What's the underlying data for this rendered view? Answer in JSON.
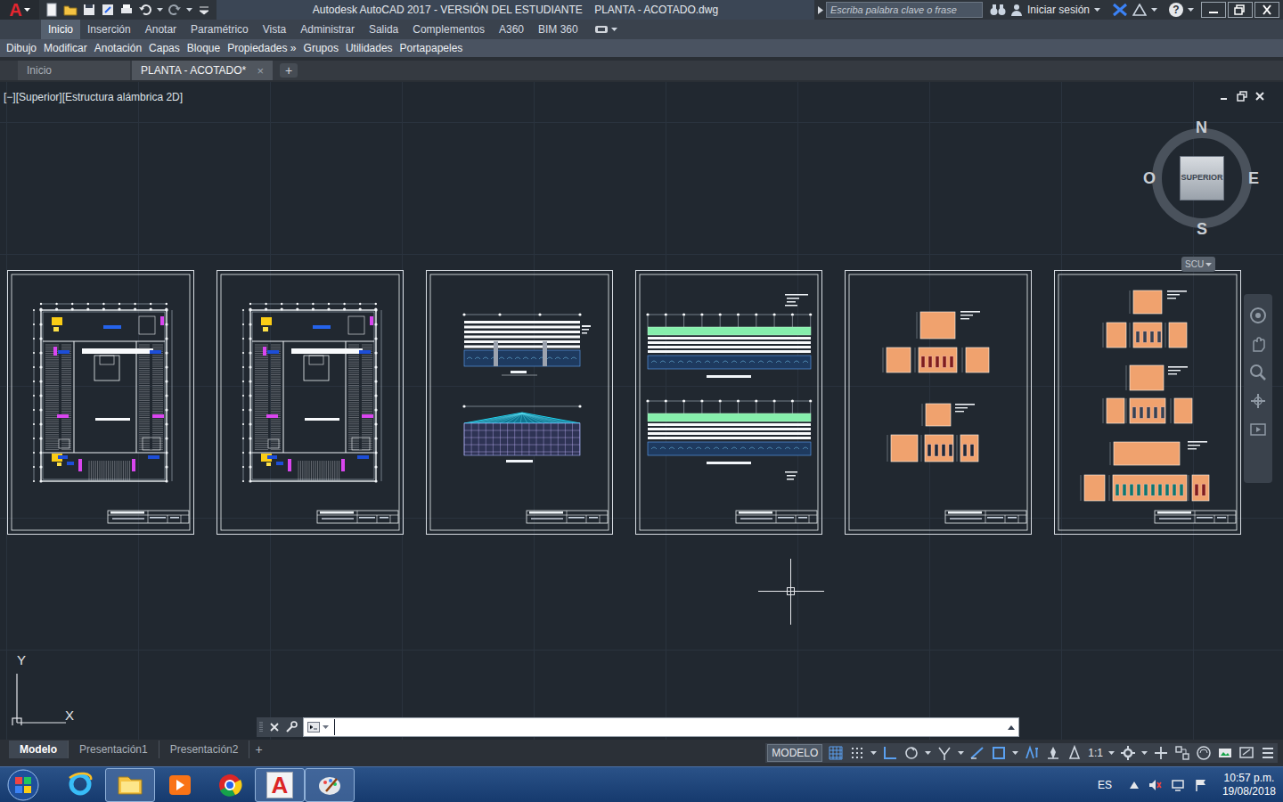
{
  "window": {
    "app_letter": "A",
    "title": "Autodesk AutoCAD 2017 - VERSIÓN DEL ESTUDIANTE    PLANTA - ACOTADO.dwg"
  },
  "search": {
    "placeholder": "Escriba palabra clave o frase"
  },
  "user": {
    "label": "Iniciar sesión"
  },
  "help": {
    "label": "?"
  },
  "ribbon_tabs": [
    {
      "label": "Inicio",
      "selected": true
    },
    {
      "label": "Inserción",
      "selected": false
    },
    {
      "label": "Anotar",
      "selected": false
    },
    {
      "label": "Paramétrico",
      "selected": false
    },
    {
      "label": "Vista",
      "selected": false
    },
    {
      "label": "Administrar",
      "selected": false
    },
    {
      "label": "Salida",
      "selected": false
    },
    {
      "label": "Complementos",
      "selected": false
    },
    {
      "label": "A360",
      "selected": false
    },
    {
      "label": "BIM 360",
      "selected": false
    }
  ],
  "panels": [
    "Dibujo",
    "Modificar",
    "Anotación",
    "Capas",
    "Bloque",
    "Propiedades »",
    "Grupos",
    "Utilidades",
    "Portapapeles"
  ],
  "file_tabs": [
    {
      "label": "Inicio",
      "selected": false,
      "closable": false
    },
    {
      "label": "PLANTA - ACOTADO*",
      "selected": true,
      "closable": true
    }
  ],
  "file_tab_close": "×",
  "new_file_tab": "+",
  "viewport": {
    "label": "[−][Superior][Estructura alámbrica 2D]"
  },
  "viewcube": {
    "face": "SUPERIOR",
    "north": "N",
    "south": "S",
    "east": "E",
    "west": "O",
    "ucs": "SCU"
  },
  "ucs_axes": {
    "x": "X",
    "y": "Y"
  },
  "sheets": [
    {
      "kind": "plan"
    },
    {
      "kind": "plan"
    },
    {
      "kind": "elevation"
    },
    {
      "kind": "long-elevation"
    },
    {
      "kind": "detail-a"
    },
    {
      "kind": "detail-b"
    }
  ],
  "command_line": {
    "value": ""
  },
  "layout_tabs": [
    {
      "label": "Modelo",
      "selected": true
    },
    {
      "label": "Presentación1",
      "selected": false
    },
    {
      "label": "Presentación2",
      "selected": false
    }
  ],
  "new_layout_tab": "+",
  "status_bar": {
    "space": "MODELO",
    "scale": "1:1"
  },
  "taskbar": {
    "language": "ES",
    "time": "10:57 p.m.",
    "date": "19/08/2018"
  }
}
